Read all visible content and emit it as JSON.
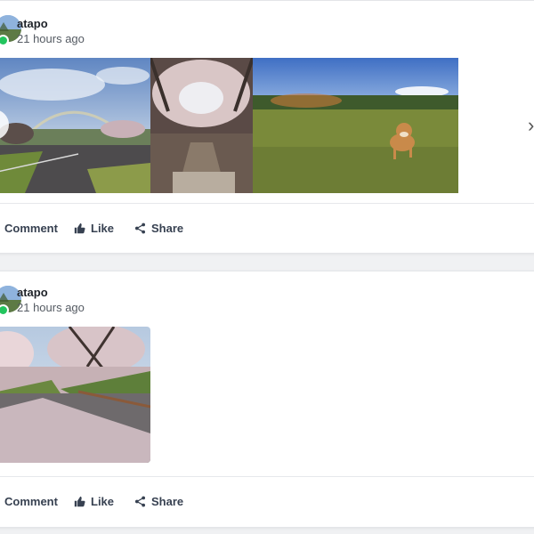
{
  "posts": [
    {
      "author": "atapo",
      "time": "21 hours ago",
      "photos": [
        "park-with-rainbow-photo",
        "cherry-blossom-path-photo",
        "shiba-dog-on-grass-photo"
      ],
      "actions": {
        "comment": "Comment",
        "like": "Like",
        "share": "Share"
      }
    },
    {
      "author": "atapo",
      "time": "21 hours ago",
      "photos": [
        "cherry-blossom-moat-photo"
      ],
      "actions": {
        "comment": "Comment",
        "like": "Like",
        "share": "Share"
      }
    }
  ],
  "icons": {
    "like": "thumbs-up-icon",
    "share": "share-icon",
    "prev": "chevron-left-icon",
    "next": "chevron-right-icon"
  },
  "colors": {
    "online": "#22c55e",
    "background": "#f0f1f3",
    "card": "#ffffff"
  }
}
